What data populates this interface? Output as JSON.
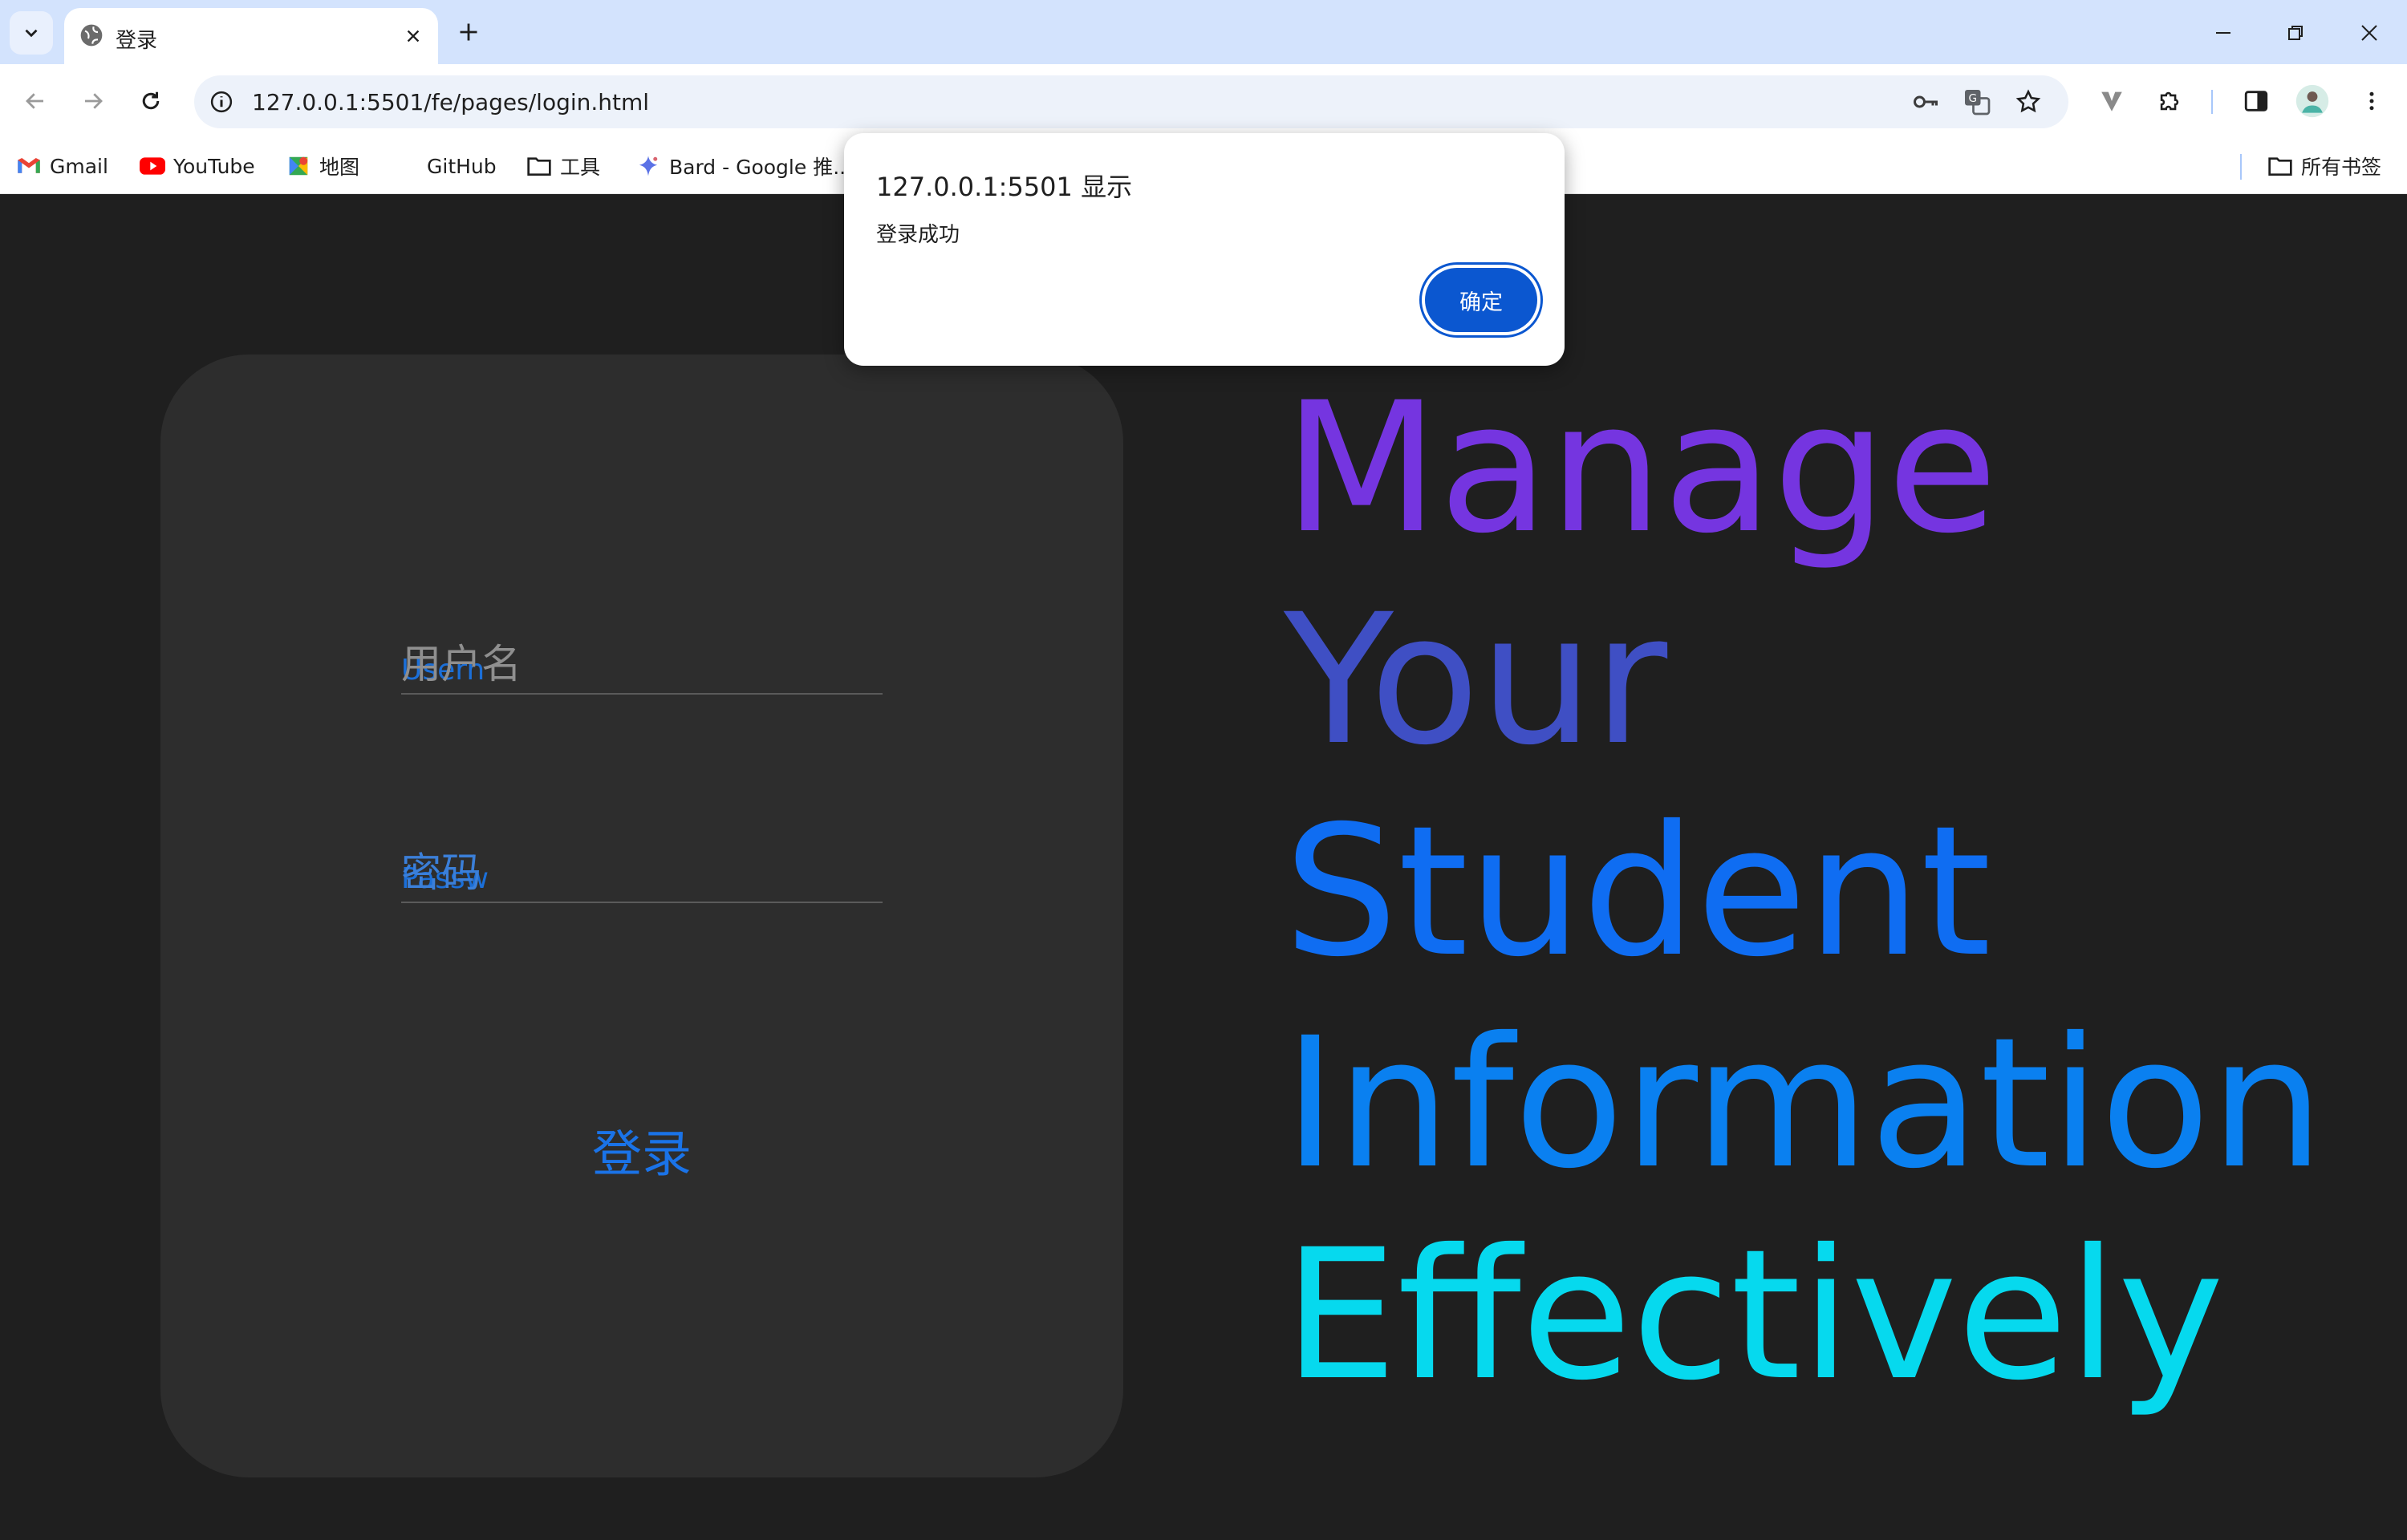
{
  "browser": {
    "tab": {
      "title": "登录"
    },
    "address_bar": {
      "url": "127.0.0.1:5501/fe/pages/login.html"
    },
    "bookmarks": [
      {
        "label": "Gmail",
        "icon": "gmail-icon"
      },
      {
        "label": "YouTube",
        "icon": "youtube-icon"
      },
      {
        "label": "地图",
        "icon": "maps-icon"
      },
      {
        "label": "GitHub",
        "icon": "github-icon"
      },
      {
        "label": "工具",
        "icon": "folder-icon"
      },
      {
        "label": "Bard - Google 推...",
        "icon": "bard-icon"
      }
    ],
    "all_bookmarks_label": "所有书签"
  },
  "login": {
    "username_placeholder": "用户名",
    "username_label": "Usern",
    "password_placeholder": "密码",
    "password_label": "Passw",
    "login_button": "登录"
  },
  "slogan": {
    "lines": [
      "Manage",
      "Your",
      "Student",
      "Information",
      "Effectively"
    ],
    "colors": [
      "#7535e0",
      "#3f4fc4",
      "#0f6df2",
      "#0a80f0",
      "#06d9ee"
    ]
  },
  "alert": {
    "title": "127.0.0.1:5501 显示",
    "message": "登录成功",
    "ok_label": "确定"
  },
  "colors": {
    "tabbar": "#d3e3fd",
    "page_bg": "#1f1f1f",
    "card_bg": "#2d2d2d",
    "accent": "#1a73e8",
    "dialog_button": "#0b57d0"
  }
}
